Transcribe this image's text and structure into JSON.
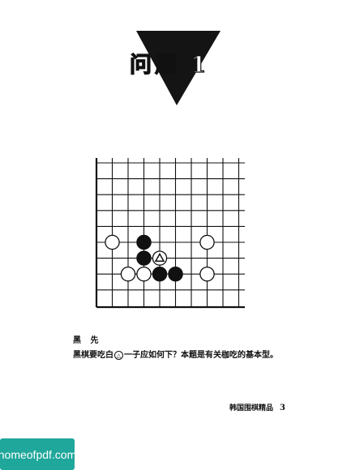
{
  "header": {
    "title": "问题 1"
  },
  "diagram": {
    "stones": [
      {
        "color": "white",
        "col": 1,
        "row": 5
      },
      {
        "color": "black",
        "col": 3,
        "row": 5
      },
      {
        "color": "white",
        "col": 7,
        "row": 5
      },
      {
        "color": "black",
        "col": 3,
        "row": 6
      },
      {
        "color": "white",
        "col": 4,
        "row": 6,
        "mark": "triangle"
      },
      {
        "color": "white",
        "col": 2,
        "row": 7
      },
      {
        "color": "white",
        "col": 3,
        "row": 7
      },
      {
        "color": "black",
        "col": 4,
        "row": 7
      },
      {
        "color": "black",
        "col": 5,
        "row": 7
      },
      {
        "color": "white",
        "col": 7,
        "row": 7
      }
    ]
  },
  "problem": {
    "to_play": "黑 先",
    "text_before": "黑棋要吃白",
    "marker": "△",
    "text_after": "一子应如何下？本题是有关枷吃的基本型。"
  },
  "footer": {
    "book": "韩国围棋精品",
    "page": "3"
  },
  "watermark": {
    "text": "homeofpdf.com"
  }
}
